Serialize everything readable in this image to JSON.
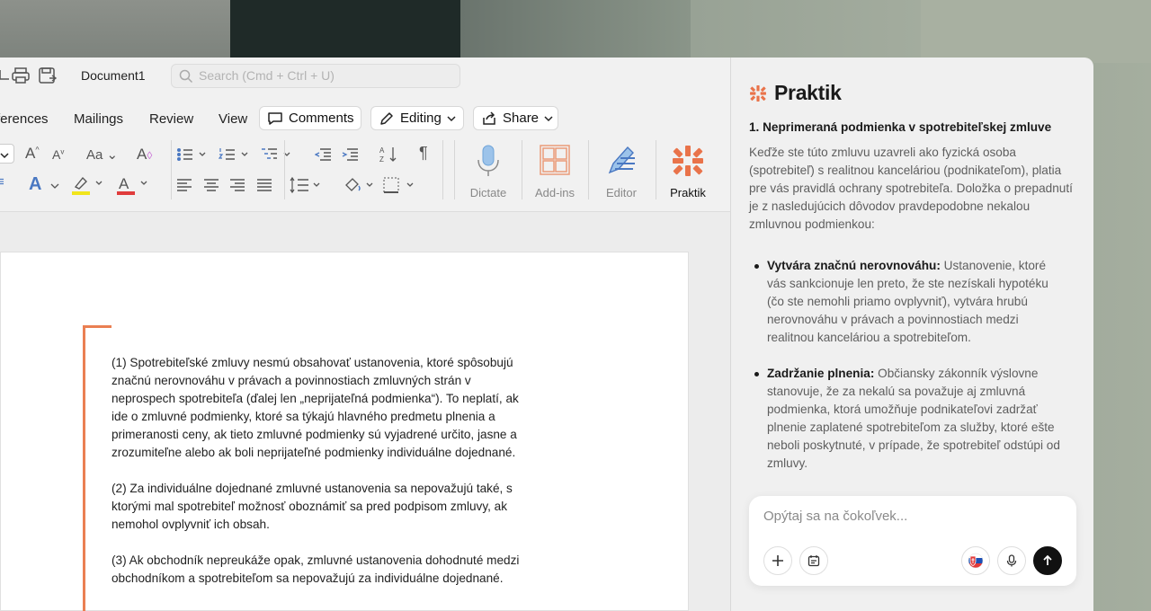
{
  "titlebar": {
    "doc_title": "Document1",
    "search_placeholder": "Search (Cmd + Ctrl + U)"
  },
  "tabs": [
    "ferences",
    "Mailings",
    "Review",
    "View"
  ],
  "toolbar": {
    "comments_label": "Comments",
    "editing_label": "Editing",
    "share_label": "Share"
  },
  "ribbon": {
    "dictate": "Dictate",
    "addins": "Add-ins",
    "editor": "Editor",
    "praktik": "Praktik"
  },
  "document": {
    "paragraphs": [
      "(1) Spotrebiteľské zmluvy nesmú obsahovať ustanovenia, ktoré spôsobujú značnú nerovnováhu v právach a povinnostiach zmluvných strán v neprospech spotrebiteľa (ďalej len „neprijateľná podmienka“). To neplatí, ak ide o zmluvné podmienky, ktoré sa týkajú hlavného predmetu plnenia a primeranosti ceny, ak tieto zmluvné podmienky sú vyjadrené určito, jasne a zrozumiteľne alebo ak boli neprijateľné podmienky individuálne dojednané.",
      "(2) Za individuálne dojednané zmluvné ustanovenia sa nepovažujú také, s ktorými mal spotrebiteľ možnosť oboznámiť sa pred podpisom zmluvy, ak nemohol ovplyvniť ich obsah.",
      "(3) Ak obchodník nepreukáže opak, zmluvné ustanovenia dohodnuté medzi obchodníkom a spotrebiteľom sa nepovažujú za individuálne dojednané."
    ]
  },
  "panel": {
    "brand": "Praktik",
    "heading": "1. Neprimeraná podmienka v spotrebiteľskej zmluve",
    "intro": "Keďže ste túto zmluvu uzavreli ako fyzická osoba (spotrebiteľ) s realitnou kanceláriou (podnikateľom), platia pre vás pravidlá ochrany spotrebiteľa. Doložka o prepadnutí je z nasledujúcich dôvodov pravdepodobne nekalou zmluvnou podmienkou:",
    "bullets": [
      {
        "title": "Vytvára značnú nerovnováhu:",
        "text": " Ustanovenie, ktoré vás sankcionuje len preto, že ste nezískali hypotéku (čo ste nemohli priamo ovplyvniť), vytvára hrubú nerovnováhu v právach a povinnostiach medzi realitnou kanceláriou a spotrebiteľom."
      },
      {
        "title": "Zadržanie plnenia:",
        "text": " Občiansky zákonník výslovne stanovuje, že za nekalú sa považuje aj zmluvná podmienka, ktorá umožňuje podnikateľovi zadržať plnenie zaplatené spotrebiteľom za služby, ktoré ešte neboli poskytnuté, v prípade, že spotrebiteľ odstúpi od zmluvy."
      }
    ],
    "chat_placeholder": "Opýtaj sa na čokoľvek...",
    "accent": "#ea7f52"
  }
}
